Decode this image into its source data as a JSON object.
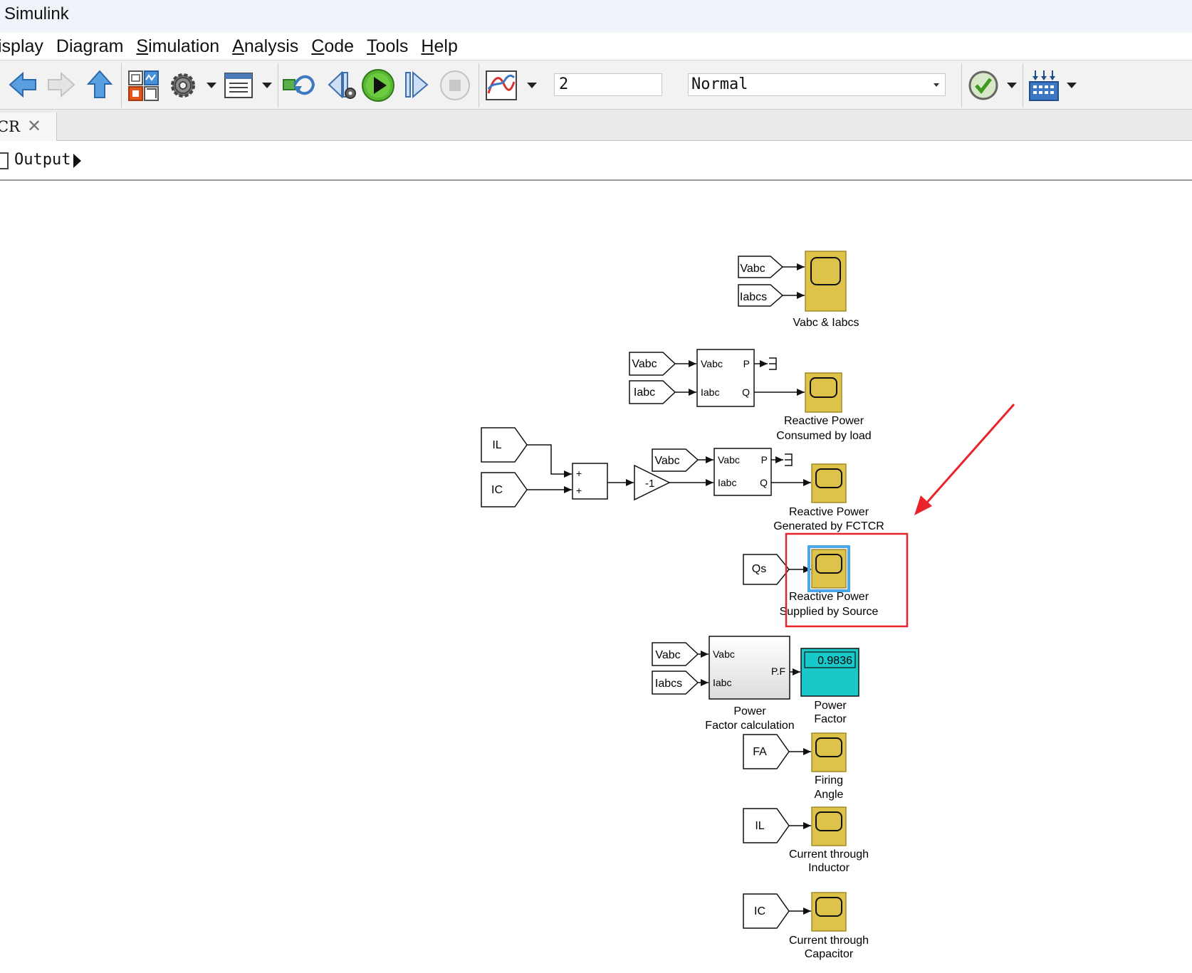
{
  "window": {
    "title": "Simulink"
  },
  "menubar": {
    "items": [
      {
        "pre": "",
        "ul": "",
        "post": "isplay"
      },
      {
        "pre": "Dia",
        "ul": "g",
        "post": "ram"
      },
      {
        "pre": "",
        "ul": "S",
        "post": "imulation"
      },
      {
        "pre": "",
        "ul": "A",
        "post": "nalysis"
      },
      {
        "pre": "",
        "ul": "C",
        "post": "ode"
      },
      {
        "pre": "",
        "ul": "T",
        "post": "ools"
      },
      {
        "pre": "",
        "ul": "H",
        "post": "elp"
      }
    ]
  },
  "toolbar": {
    "stop_time": "2",
    "sim_mode": "Normal",
    "icons": [
      "back-arrow-icon",
      "forward-arrow-icon",
      "up-arrow-icon",
      "library-browser-icon",
      "model-config-gear-icon",
      "model-explorer-icon",
      "update-diagram-icon",
      "step-back-icon",
      "run-play-icon",
      "step-forward-icon",
      "stop-icon",
      "simulation-data-inspector-icon",
      "model-advisor-check-icon",
      "build-model-icon"
    ]
  },
  "tabs": [
    {
      "label": "CR",
      "close": "✕"
    }
  ],
  "breadcrumb": {
    "label": "Output"
  },
  "diagram": {
    "scope1": {
      "in1": "Vabc",
      "in2": "Iabcs",
      "caption1": "Vabc & Iabcs"
    },
    "pq1": {
      "in1": "Vabc",
      "in2": "Iabc",
      "port_in1": "Vabc",
      "port_in2": "Iabc",
      "port_out1": "P",
      "port_out2": "Q"
    },
    "scope2": {
      "caption1": "Reactive Power",
      "caption2": "Consumed by load"
    },
    "sum": {
      "in1": "IL",
      "in2": "IC",
      "sign1": "+",
      "sign2": "+"
    },
    "gain": {
      "value": "-1"
    },
    "pq2": {
      "in1": "Vabc",
      "port_in1": "Vabc",
      "port_in2": "Iabc",
      "port_out1": "P",
      "port_out2": "Q"
    },
    "scope3": {
      "caption1": "Reactive Power",
      "caption2": "Generated by FCTCR"
    },
    "scope4": {
      "in1": "Qs",
      "caption1": "Reactive Power",
      "caption2": "Supplied by Source"
    },
    "pf": {
      "in1": "Vabc",
      "in2": "Iabcs",
      "port_in1": "Vabc",
      "port_in2": "Iabc",
      "port_out1": "P.F",
      "caption1": "Power",
      "caption2": "Factor calculation"
    },
    "display": {
      "value": "0.9836",
      "caption1": "Power",
      "caption2": "Factor"
    },
    "scope5": {
      "in1": "FA",
      "caption1": "Firing",
      "caption2": "Angle"
    },
    "scope6": {
      "in1": "IL",
      "caption1": "Current through",
      "caption2": "Inductor"
    },
    "scope7": {
      "in1": "IC",
      "caption1": "Current through",
      "caption2": "Capacitor"
    }
  },
  "annotation": {
    "highlight_color": "#e8232a"
  }
}
